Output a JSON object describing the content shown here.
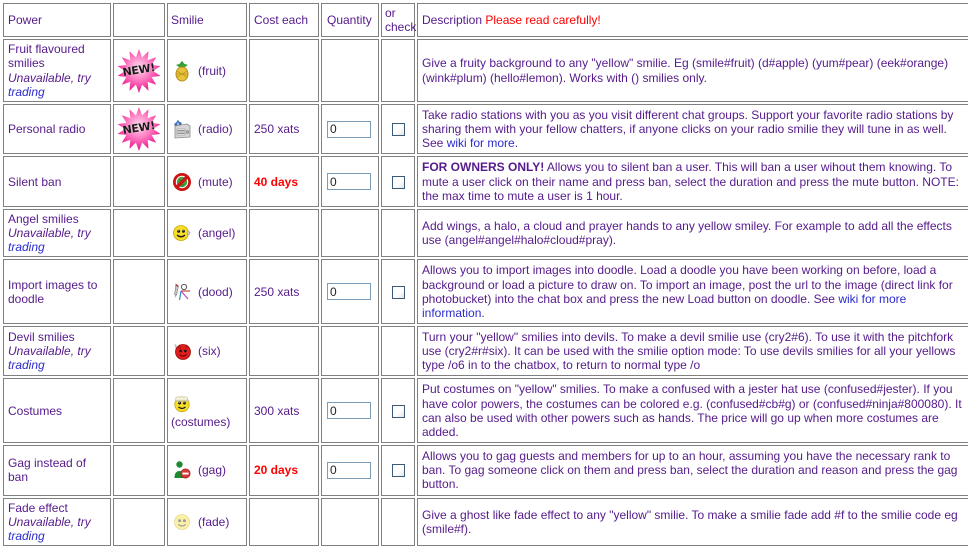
{
  "table": {
    "headers": {
      "power": "Power",
      "new": "",
      "smilie": "Smilie",
      "cost": "Cost each",
      "quantity": "Quantity",
      "check": "or\ncheck",
      "check_line1": "or",
      "check_line2": "check",
      "description": "Description ",
      "description_warning": "Please read carefully!"
    },
    "colors": {
      "text": "#551a8b",
      "link": "#2b2bcd",
      "warning": "#ff0000",
      "border": "#808080",
      "input_border": "#7a9cb4"
    },
    "unavailable_text": "Unavailable, try ",
    "unavailable_link": "trading",
    "rows": [
      {
        "power": "Fruit flavoured smilies",
        "unavailable": true,
        "new_badge": "NEW!",
        "smilie_icon": "pineapple-icon",
        "smilie_code": "(fruit)",
        "smilie_layout": "inline",
        "cost": "",
        "cost_style": "none",
        "quantity": null,
        "checkbox": false,
        "description_parts": [
          {
            "type": "text",
            "value": "Give a fruity background to any \"yellow\" smilie. Eg (smile#fruit) (d#apple) (yum#pear) (eek#orange) (wink#plum) (hello#lemon). Works with () smilies only."
          }
        ]
      },
      {
        "power": "Personal radio",
        "unavailable": false,
        "new_badge": "NEW!",
        "smilie_icon": "radio-icon",
        "smilie_code": "(radio)",
        "smilie_layout": "inline",
        "cost": "250 xats",
        "cost_style": "normal",
        "quantity": "0",
        "checkbox": true,
        "description_parts": [
          {
            "type": "text",
            "value": "Take radio stations with you as you visit different chat groups. Support your favorite radio stations by sharing them with your fellow chatters, if anyone clicks on your radio smilie they will tune in as well. See "
          },
          {
            "type": "link",
            "value": "wiki for more"
          },
          {
            "type": "text",
            "value": "."
          }
        ]
      },
      {
        "power": "Silent ban",
        "unavailable": false,
        "new_badge": "",
        "smilie_icon": "mute-icon",
        "smilie_code": "(mute)",
        "smilie_layout": "inline",
        "cost": "40 days",
        "cost_style": "red",
        "quantity": "0",
        "checkbox": true,
        "description_parts": [
          {
            "type": "bold",
            "value": "FOR OWNERS ONLY!"
          },
          {
            "type": "text",
            "value": " Allows you to silent ban a user. This will ban a user wihout them knowing. To mute a user click on their name and press ban, select the duration and press the mute button. NOTE: the max time to mute a user is 1 hour."
          }
        ]
      },
      {
        "power": "Angel smilies",
        "unavailable": true,
        "new_badge": "",
        "smilie_icon": "angel-icon",
        "smilie_code": "(angel)",
        "smilie_layout": "inline",
        "cost": "",
        "cost_style": "none",
        "quantity": null,
        "checkbox": false,
        "description_parts": [
          {
            "type": "text",
            "value": "Add wings, a halo, a cloud and prayer hands to any yellow smiley. For example to add all the effects use (angel#angel#halo#cloud#pray)."
          }
        ]
      },
      {
        "power": "Import images to doodle",
        "unavailable": false,
        "new_badge": "",
        "smilie_icon": "doodle-icon",
        "smilie_code": "(dood)",
        "smilie_layout": "inline",
        "cost": "250 xats",
        "cost_style": "normal",
        "quantity": "0",
        "checkbox": true,
        "description_parts": [
          {
            "type": "text",
            "value": "Allows you to import images into doodle. Load a doodle you have been working on before, load a background or load a picture to draw on. To import an image, post the url to the image (direct link for photobucket) into the chat box and press the new Load button on doodle. See "
          },
          {
            "type": "link",
            "value": "wiki for more information"
          },
          {
            "type": "text",
            "value": "."
          }
        ]
      },
      {
        "power": "Devil smilies",
        "unavailable": true,
        "new_badge": "",
        "smilie_icon": "devil-icon",
        "smilie_code": "(six)",
        "smilie_layout": "inline",
        "cost": "",
        "cost_style": "none",
        "quantity": null,
        "checkbox": false,
        "description_parts": [
          {
            "type": "text",
            "value": "Turn your \"yellow\" smilies into devils. To make a devil smilie use (cry2#6). To use it with the pitchfork use (cry2#r#six). It can be used with the smilie option mode: To use devils smilies for all your yellows type /o6 in to the chatbox, to return to normal type /o"
          }
        ]
      },
      {
        "power": "Costumes",
        "unavailable": false,
        "new_badge": "",
        "smilie_icon": "costumes-icon",
        "smilie_code": "(costumes)",
        "smilie_layout": "stacked",
        "cost": "300 xats",
        "cost_style": "normal",
        "quantity": "0",
        "checkbox": true,
        "description_parts": [
          {
            "type": "text",
            "value": "Put costumes on \"yellow\" smilies. To make a confused with a jester hat use (confused#jester). If you have color powers, the costumes can be colored e.g. (confused#cb#g) or (confused#ninja#800080). It can also be used with other powers such as hands. The price will go up when more costumes are added."
          }
        ]
      },
      {
        "power": "Gag instead of ban",
        "unavailable": false,
        "new_badge": "",
        "smilie_icon": "gag-icon",
        "smilie_code": "(gag)",
        "smilie_layout": "inline",
        "cost": "20 days",
        "cost_style": "red",
        "quantity": "0",
        "checkbox": true,
        "description_parts": [
          {
            "type": "text",
            "value": "Allows you to gag guests and members for up to an hour, assuming you have the necessary rank to ban. To gag someone click on them and press ban, select the duration and reason and press the gag button."
          }
        ]
      },
      {
        "power": "Fade effect",
        "unavailable": true,
        "new_badge": "",
        "smilie_icon": "fade-icon",
        "smilie_code": "(fade)",
        "smilie_layout": "inline",
        "cost": "",
        "cost_style": "none",
        "quantity": null,
        "checkbox": false,
        "description_parts": [
          {
            "type": "text",
            "value": "Give a ghost like fade effect to any \"yellow\" smilie. To make a smilie fade add #f to the smilie code eg (smile#f)."
          }
        ]
      }
    ]
  }
}
